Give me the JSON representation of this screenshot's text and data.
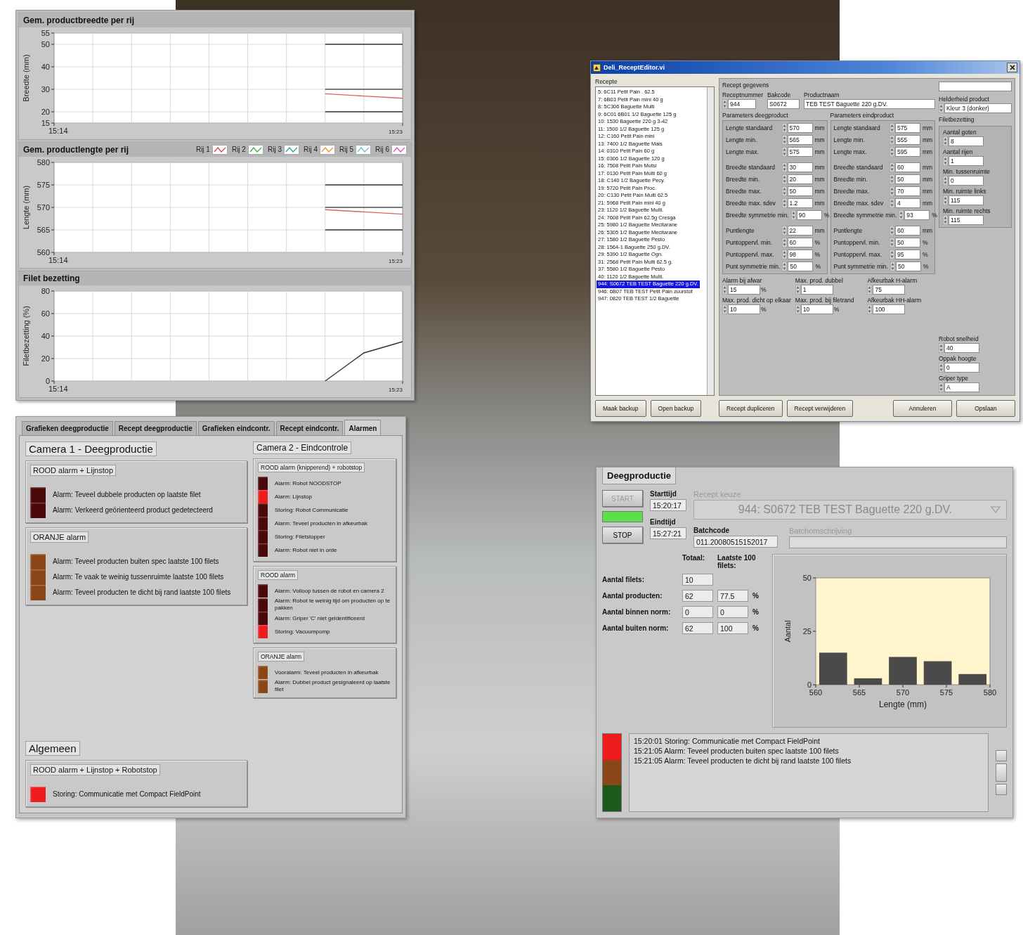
{
  "charts_panel": {
    "charts": [
      {
        "chart_data": {
          "type": "line",
          "title": "Gem. productbreedte per rij",
          "ylabel": "Breedte (mm)",
          "categories": [
            "15:14",
            null,
            null,
            null,
            null,
            null,
            null,
            null,
            null,
            "15:23"
          ],
          "ylim": [
            15,
            55
          ],
          "grid": true,
          "yticks": [
            15,
            20,
            30,
            40,
            50,
            55
          ],
          "series": [
            {
              "color": "#333333",
              "values": [
                null,
                null,
                null,
                null,
                null,
                null,
                null,
                50,
                50,
                50
              ]
            },
            {
              "color": "#555555",
              "values": [
                null,
                null,
                null,
                null,
                null,
                null,
                null,
                30,
                30,
                30
              ]
            },
            {
              "color": "#333333",
              "values": [
                null,
                null,
                null,
                null,
                null,
                null,
                null,
                20,
                20,
                20
              ]
            },
            {
              "color": "#e06060",
              "values": [
                null,
                null,
                null,
                null,
                null,
                null,
                null,
                28,
                27,
                26
              ]
            }
          ]
        }
      },
      {
        "chart_data": {
          "type": "line",
          "title": "Gem. productlengte per rij",
          "ylabel": "Lengte (mm)",
          "categories": [
            "15:14",
            null,
            null,
            null,
            null,
            null,
            null,
            null,
            null,
            "15:23"
          ],
          "ylim": [
            560,
            580
          ],
          "grid": true,
          "yticks": [
            560,
            565,
            570,
            575,
            580
          ],
          "series": [
            {
              "color": "#333333",
              "values": [
                null,
                null,
                null,
                null,
                null,
                null,
                null,
                575,
                575,
                575
              ]
            },
            {
              "color": "#555555",
              "values": [
                null,
                null,
                null,
                null,
                null,
                null,
                null,
                570,
                570,
                570
              ]
            },
            {
              "color": "#333333",
              "values": [
                null,
                null,
                null,
                null,
                null,
                null,
                null,
                565,
                565,
                565
              ]
            },
            {
              "color": "#e06060",
              "values": [
                null,
                null,
                null,
                null,
                null,
                null,
                null,
                569.5,
                569,
                568.5
              ]
            }
          ]
        },
        "legend": [
          {
            "label": "Rij 1",
            "color": "#e04040"
          },
          {
            "label": "Rij 2",
            "color": "#40b040"
          },
          {
            "label": "Rij 3",
            "color": "#20a0a0"
          },
          {
            "label": "Rij 4",
            "color": "#f09030"
          },
          {
            "label": "Rij 5",
            "color": "#60c0e0"
          },
          {
            "label": "Rij 6",
            "color": "#e050c0"
          }
        ]
      },
      {
        "chart_data": {
          "type": "line",
          "title": "Filet bezetting",
          "ylabel": "Filetbezetting (%)",
          "categories": [
            "15:14",
            null,
            null,
            null,
            null,
            null,
            null,
            null,
            null,
            "15:23"
          ],
          "ylim": [
            0,
            80
          ],
          "grid": true,
          "yticks": [
            0,
            20,
            40,
            60,
            80
          ],
          "series": [
            {
              "color": "#333333",
              "values": [
                null,
                null,
                null,
                null,
                null,
                null,
                null,
                0,
                25,
                35
              ]
            }
          ]
        }
      }
    ]
  },
  "recipe_dialog": {
    "title": "Deli_ReceptEditor.vi",
    "list_label": "Recepte",
    "recipes": [
      {
        "text": "5: 6C11 Petit Pain . 62.5",
        "selected": false
      },
      {
        "text": "7: 6B03 Petit Pain mini 40 g",
        "selected": false
      },
      {
        "text": "8: 5C306 Baguette Multi",
        "selected": false
      },
      {
        "text": "9: 6C01 6B01 1/2 Baguette 125 g",
        "selected": false
      },
      {
        "text": "10: 1530 Baguette 220 g 3-42",
        "selected": false
      },
      {
        "text": "11: 1500 1/2 Baguette 125 g",
        "selected": false
      },
      {
        "text": "12: C160 Petit Pain mini",
        "selected": false
      },
      {
        "text": "13: 7400 1/2 Baguette Mais",
        "selected": false
      },
      {
        "text": "14: 0310 Petit Pain 60 g",
        "selected": false
      },
      {
        "text": "15: 0306 1/2 Baguette 120 g",
        "selected": false
      },
      {
        "text": "16: 7508 Petit Pain Mutsi",
        "selected": false
      },
      {
        "text": "17: 0130 Petit Pain Multi 60 g",
        "selected": false
      },
      {
        "text": "18: C140 1/2 Baguette Pecy.",
        "selected": false
      },
      {
        "text": "19: 5720 Petit Pain Proc.",
        "selected": false
      },
      {
        "text": "20: C130 Petit Pain Multi 62.5",
        "selected": false
      },
      {
        "text": "21: 5968 Petit Pain mini 40 g",
        "selected": false
      },
      {
        "text": "23: 1120 1/2 Baguette Multi.",
        "selected": false
      },
      {
        "text": "24: 7608 Petit Pain 62.5g Cresga",
        "selected": false
      },
      {
        "text": "25: 5980 1/2 Baguette Mecitarane",
        "selected": false
      },
      {
        "text": "26: 5305 1/2 Baguette Mecitarane",
        "selected": false
      },
      {
        "text": "27: 1580 1/2 Baguette Pesto",
        "selected": false
      },
      {
        "text": "28: 1564-1 Baguette 250 g.DV.",
        "selected": false
      },
      {
        "text": "29: 5390 1/2 Baguette Ogn.",
        "selected": false
      },
      {
        "text": "31: 2568 Petit Pain Multi 62.5 g.",
        "selected": false
      },
      {
        "text": "37: 5580 1/2 Baguette Pesto",
        "selected": false
      },
      {
        "text": "40: 1120 1/2 Baguette Multi.",
        "selected": false
      },
      {
        "text": "944: S0672 TEB TEST Baguette 220 g.DV.",
        "selected": true
      },
      {
        "text": "946: 6B07 TEB TEST Petit Pain zuurstof",
        "selected": false
      },
      {
        "text": "947: 0820 TEB TEST 1/2 Baguette",
        "selected": false
      }
    ],
    "data_label": "Recept gegevens",
    "header_fields": [
      {
        "label": "Receptnummer",
        "value": "944",
        "spinner": true
      },
      {
        "label": "Bakcode",
        "value": "S0672",
        "spinner": false
      },
      {
        "label": "Productnaam",
        "value": "TEB TEST Baguette 220 g.DV.",
        "spinner": false
      }
    ],
    "brightness": {
      "label": "Helderheid product",
      "value": "Kleur 3 (donker)"
    },
    "param_groups": [
      {
        "title": "Parameters deegproduct",
        "blocks": [
          [
            {
              "label": "Lengte standaard",
              "value": "570",
              "unit": "mm"
            },
            {
              "label": "Lengte min.",
              "value": "565",
              "unit": "mm"
            },
            {
              "label": "Lengte max.",
              "value": "575",
              "unit": "mm"
            }
          ],
          [
            {
              "label": "Breedte standaard",
              "value": "30",
              "unit": "mm"
            },
            {
              "label": "Breedte min.",
              "value": "20",
              "unit": "mm"
            },
            {
              "label": "Breedte max.",
              "value": "50",
              "unit": "mm"
            },
            {
              "label": "Breedte max. sdev",
              "value": "1.2",
              "unit": "mm"
            },
            {
              "label": "Breedte symmetrie min.",
              "value": "90",
              "unit": "%"
            }
          ],
          [
            {
              "label": "Puntlengte",
              "value": "22",
              "unit": "mm"
            },
            {
              "label": "Puntoppervl. min.",
              "value": "60",
              "unit": "%"
            },
            {
              "label": "Puntoppervl. max.",
              "value": "98",
              "unit": "%"
            },
            {
              "label": "Punt symmetrie min.",
              "value": "50",
              "unit": "%"
            }
          ]
        ]
      },
      {
        "title": "Parameters eindproduct",
        "blocks": [
          [
            {
              "label": "Lengte standaard",
              "value": "575",
              "unit": "mm"
            },
            {
              "label": "Lengte min.",
              "value": "555",
              "unit": "mm"
            },
            {
              "label": "Lengte max.",
              "value": "595",
              "unit": "mm"
            }
          ],
          [
            {
              "label": "Breedte standaard",
              "value": "60",
              "unit": "mm"
            },
            {
              "label": "Breedte min.",
              "value": "50",
              "unit": "mm"
            },
            {
              "label": "Breedte max.",
              "value": "70",
              "unit": "mm"
            },
            {
              "label": "Breedte max. sdev",
              "value": "4",
              "unit": "mm"
            },
            {
              "label": "Breedte symmetrie min.",
              "value": "93",
              "unit": "%"
            }
          ],
          [
            {
              "label": "Puntlengte",
              "value": "60",
              "unit": "mm"
            },
            {
              "label": "Puntoppervl. min.",
              "value": "50",
              "unit": "%"
            },
            {
              "label": "Puntoppervl. max.",
              "value": "95",
              "unit": "%"
            },
            {
              "label": "Punt symmetrie min.",
              "value": "50",
              "unit": "%"
            }
          ]
        ]
      }
    ],
    "extra_fields": [
      {
        "label": "Alarm bij afwar",
        "value": "15",
        "unit": "%"
      },
      {
        "label": "Max. prod. dubbel",
        "value": "1"
      },
      {
        "label": "Afkeurbak H-alarm",
        "value": "75"
      },
      {
        "label": "Max. prod. dicht op elkaar",
        "value": "10",
        "unit": "%"
      },
      {
        "label": "Max. prod. bij filetrand",
        "value": "10",
        "unit": "%"
      },
      {
        "label": "Afkeurbak HH-alarm",
        "value": "100"
      }
    ],
    "filet_group": {
      "title": "Filetbezetting",
      "fields": [
        {
          "label": "Aantal goten",
          "value": "8"
        },
        {
          "label": "Aantal rijen",
          "value": "1"
        },
        {
          "label": "Min. tussenruimte",
          "value": "0"
        },
        {
          "label": "Min. ruimte links",
          "value": "115"
        },
        {
          "label": "Min. ruimte rechts",
          "value": "115"
        }
      ]
    },
    "robot_fields": [
      {
        "label": "Robot snelheid",
        "value": "40"
      },
      {
        "label": "Oppak hoogte",
        "value": "0"
      },
      {
        "label": "Griper type",
        "value": "A"
      }
    ],
    "list_buttons": [
      "Maak backup",
      "Open backup"
    ],
    "recipe_buttons": [
      "Recept dupliceren",
      "Recept verwijderen"
    ],
    "dialog_buttons": [
      "Annuleren",
      "Opslaan"
    ]
  },
  "alarms_panel": {
    "tabs": [
      {
        "label": "Grafieken deegproductie",
        "selected": false
      },
      {
        "label": "Recept deegproductie",
        "selected": false
      },
      {
        "label": "Grafieken eindcontr.",
        "selected": false
      },
      {
        "label": "Recept eindcontr.",
        "selected": false
      },
      {
        "label": "Alarmen",
        "selected": true
      }
    ],
    "columns": [
      {
        "title": "Camera 1 - Deegproductie",
        "groups": [
          {
            "title": "ROOD alarm + Lijnstop",
            "kind": "red",
            "alarms": [
              {
                "text": "Alarm: Teveel dubbele producten op laatste filet",
                "on": false
              },
              {
                "text": "Alarm: Verkeerd geörienteerd product gedetecteerd",
                "on": false
              }
            ]
          },
          {
            "title": "ORANJE alarm",
            "kind": "orange",
            "alarms": [
              {
                "text": "Alarm: Teveel producten buiten spec laatste 100 filets",
                "on": false
              },
              {
                "text": "Alarm: Te vaak te weinig tussenruimte laatste 100 filets",
                "on": false
              },
              {
                "text": "Alarm: Teveel producten te dicht bij rand laatste 100 filets",
                "on": false
              }
            ]
          }
        ]
      },
      {
        "title": "Camera 2 - Eindcontrole",
        "groups": [
          {
            "title": "ROOD alarm (knipperend) + robotstop",
            "kind": "red",
            "alarms": [
              {
                "text": "Alarm: Robot NOODSTOP",
                "on": false
              },
              {
                "text": "Alarm: Lijnstop",
                "on": true
              },
              {
                "text": "Storing: Robot Communicatie",
                "on": false
              },
              {
                "text": "Alarm: Teveel producten in afkeurbak",
                "on": false
              },
              {
                "text": "Storing: Filetstopper",
                "on": false
              },
              {
                "text": "Alarm: Robot niet in orde",
                "on": false
              }
            ]
          },
          {
            "title": "ROOD alarm",
            "kind": "red",
            "alarms": [
              {
                "text": "Alarm: Volloop tussen de robot en camera 2",
                "on": false
              },
              {
                "text": "Alarm: Robot te weinig tijd om producten op te pakken",
                "on": false
              },
              {
                "text": "Alarm: Griper 'C' niet geidentificeerd",
                "on": false
              },
              {
                "text": "Storing: Vacuumpomp",
                "on": true
              }
            ]
          },
          {
            "title": "ORANJE alarm",
            "kind": "orange",
            "alarms": [
              {
                "text": "Vooralarm: Teveel producten in afkeurbak",
                "on": false
              },
              {
                "text": "Alarm: Dubbel product gesignaleerd op laatste filet",
                "on": false
              }
            ]
          }
        ]
      }
    ],
    "general": {
      "title": "Algemeen",
      "groups": [
        {
          "title": "ROOD alarm + Lijnstop + Robotstop",
          "kind": "red",
          "alarms": [
            {
              "text": "Storing: Communicatie met Compact FieldPoint",
              "on": true
            }
          ]
        }
      ]
    }
  },
  "production_panel": {
    "tab": "Deegproductie",
    "start_button": {
      "label": "START",
      "disabled": true
    },
    "running_indicator": {
      "on": true
    },
    "stop_button": {
      "label": "STOP",
      "disabled": false
    },
    "start_time": {
      "label": "Starttijd",
      "value": "15:20:17"
    },
    "end_time": {
      "label": "Eindtijd",
      "value": "15:27:21"
    },
    "recipe_select": {
      "label": "Recept keuze",
      "value": "944:  S0672  TEB TEST Baguette 220 g.DV.",
      "disabled": true
    },
    "batchcode": {
      "label": "Batchcode",
      "value": "011.20080515152017"
    },
    "batch_description": {
      "label": "Batchomschrijving",
      "disabled": true
    },
    "counts": {
      "total_header": "Totaal:",
      "last100_header": "Laatste 100 filets:",
      "rows": [
        {
          "label": "Aantal filets:",
          "total": "10"
        },
        {
          "label": "Aantal producten:",
          "total": "62",
          "last100": "77.5",
          "unit": "%"
        },
        {
          "label": "Aantal binnen norm:",
          "total": "0",
          "last100": "0",
          "unit": "%"
        },
        {
          "label": "Aantal buiten norm:",
          "total": "62",
          "last100": "100",
          "unit": "%"
        }
      ]
    },
    "status_lights": [
      {
        "kind": "red",
        "on": true
      },
      {
        "kind": "orange",
        "on": false
      },
      {
        "kind": "green",
        "on": false
      }
    ],
    "log": [
      "15:20:01 Storing: Communicatie met Compact FieldPoint",
      "15:21:05 Alarm: Teveel producten buiten spec laatste 100 filets",
      "15:21:05 Alarm: Teveel producten te dicht bij rand laatste 100 filets"
    ],
    "histogram": {
      "chart_data": {
        "type": "bar",
        "xlabel": "Lengte (mm)",
        "ylabel": "Aantal",
        "x": [
          562,
          566,
          570,
          574,
          578
        ],
        "values": [
          15,
          3,
          13,
          11,
          5
        ],
        "xlim": [
          560,
          580
        ],
        "ylim": [
          0,
          50
        ],
        "xticks": [
          560,
          565,
          570,
          575,
          580
        ],
        "yticks": [
          0,
          25,
          50
        ]
      }
    }
  }
}
